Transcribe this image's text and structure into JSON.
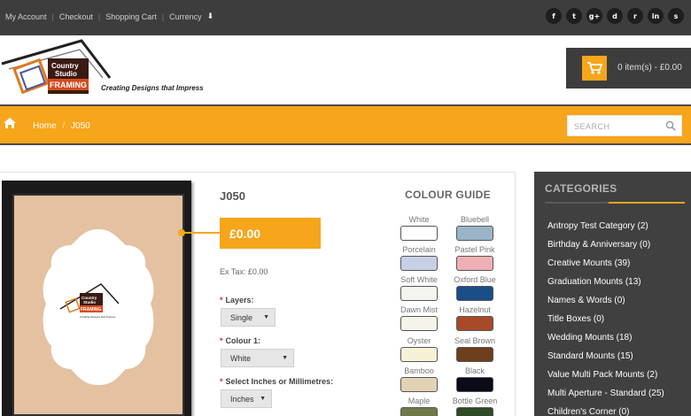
{
  "topbar": {
    "links": [
      "My Account",
      "Checkout",
      "Shopping Cart",
      "Currency"
    ],
    "social_icons": [
      {
        "name": "facebook-icon",
        "glyph": "f"
      },
      {
        "name": "twitter-icon",
        "glyph": "t"
      },
      {
        "name": "google-plus-icon",
        "glyph": "g+"
      },
      {
        "name": "delicious-icon",
        "glyph": "d"
      },
      {
        "name": "rss-icon",
        "glyph": "r"
      },
      {
        "name": "linkedin-icon",
        "glyph": "in"
      },
      {
        "name": "skype-icon",
        "glyph": "s"
      }
    ]
  },
  "header": {
    "logo_line1": "Country",
    "logo_line2": "Studio",
    "logo_line3": "FRAMING",
    "tagline": "Creating Designs that Impress",
    "cart_text": "0 item(s) - £0.00"
  },
  "nav": {
    "breadcrumb": [
      "Home",
      "J050"
    ],
    "search_placeholder": "SEARCH"
  },
  "product": {
    "title": "J050",
    "price": "£0.00",
    "ex_tax": "Ex Tax: £0.00",
    "options": [
      {
        "label": "Layers:",
        "value": "Single"
      },
      {
        "label": "Colour 1:",
        "value": "White"
      },
      {
        "label": "Select Inches or Millimetres:",
        "value": "Inches"
      }
    ]
  },
  "colour_guide": {
    "title": "COLOUR GUIDE",
    "swatches": [
      {
        "label": "White",
        "color": "#ffffff"
      },
      {
        "label": "Bluebell",
        "color": "#9ab4c8"
      },
      {
        "label": "Porcelain",
        "color": "#c8d0e6"
      },
      {
        "label": "Pastel Pink",
        "color": "#eeb0b4"
      },
      {
        "label": "Soft White",
        "color": "#f5f5f0"
      },
      {
        "label": "Oxford Blue",
        "color": "#1a4e86"
      },
      {
        "label": "Dawn Mist",
        "color": "#f6f3e8"
      },
      {
        "label": "Hazelnut",
        "color": "#a84a2a"
      },
      {
        "label": "Oyster",
        "color": "#f7f1d6"
      },
      {
        "label": "Seal Brown",
        "color": "#6e3f1c"
      },
      {
        "label": "Bamboo",
        "color": "#e2d3b4"
      },
      {
        "label": "Black",
        "color": "#0a0a18"
      },
      {
        "label": "Maple",
        "color": "#6f7a4a"
      },
      {
        "label": "Bottle Green",
        "color": "#2f4a26"
      }
    ]
  },
  "sidebar": {
    "heading": "CATEGORIES",
    "categories": [
      "Antropy Test Category (2)",
      "Birthday & Anniversary (0)",
      "Creative Mounts (39)",
      "Graduation Mounts (13)",
      "Names & Words (0)",
      "Title Boxes (0)",
      "Wedding Mounts (18)",
      "Standard Mounts (15)",
      "Value Multi Pack Mounts (2)",
      "Multi Aperture - Standard (25)",
      "Children's Corner (0)"
    ]
  },
  "colors": {
    "accent": "#f7a51b",
    "dark": "#3d3d3d",
    "sidebar": "#404040"
  }
}
